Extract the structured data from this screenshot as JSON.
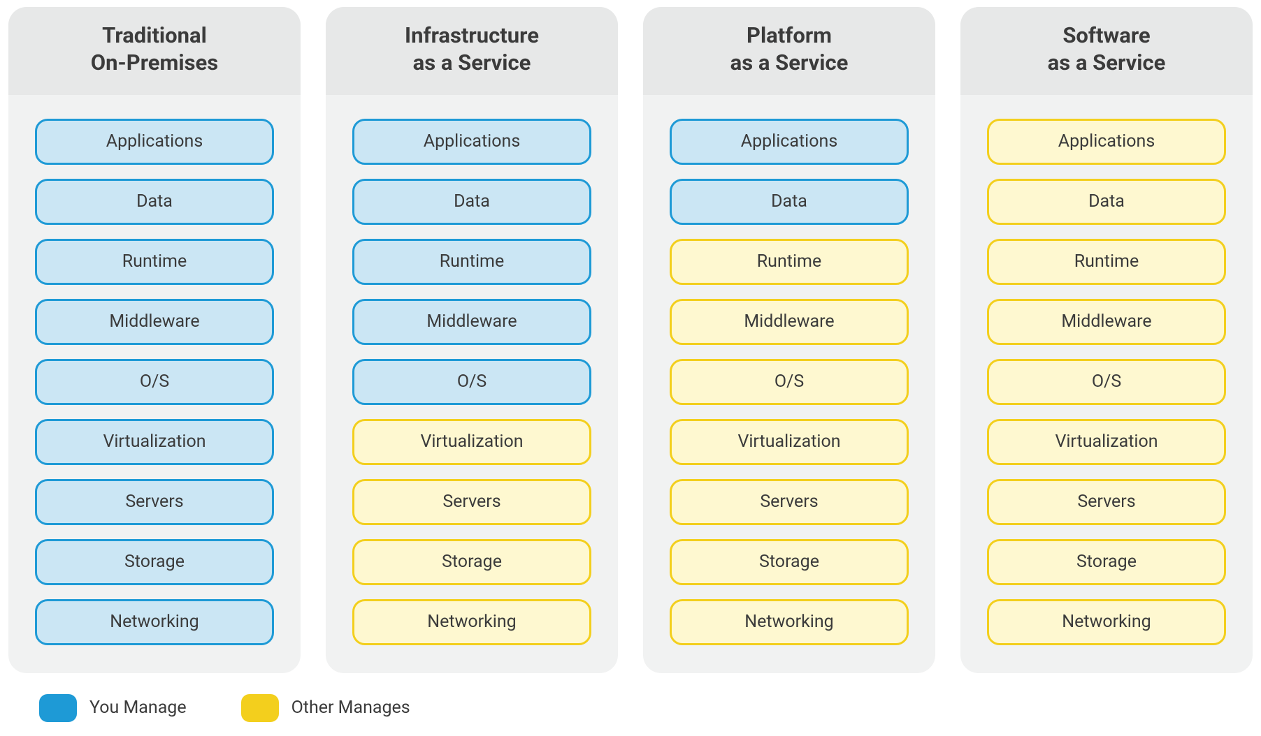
{
  "layers": [
    "Applications",
    "Data",
    "Runtime",
    "Middleware",
    "O/S",
    "Virtualization",
    "Servers",
    "Storage",
    "Networking"
  ],
  "columns": [
    {
      "title_line1": "Traditional",
      "title_line2": "On-Premises",
      "you_manage_count": 9
    },
    {
      "title_line1": "Infrastructure",
      "title_line2": "as a Service",
      "you_manage_count": 5
    },
    {
      "title_line1": "Platform",
      "title_line2": "as a Service",
      "you_manage_count": 2
    },
    {
      "title_line1": "Software",
      "title_line2": "as a Service",
      "you_manage_count": 0
    }
  ],
  "legend": {
    "you": "You Manage",
    "other": "Other Manages"
  },
  "colors": {
    "you_fill": "#cbe6f4",
    "you_border": "#1e9ad6",
    "other_fill": "#fef8d0",
    "other_border": "#f3cf1d"
  }
}
